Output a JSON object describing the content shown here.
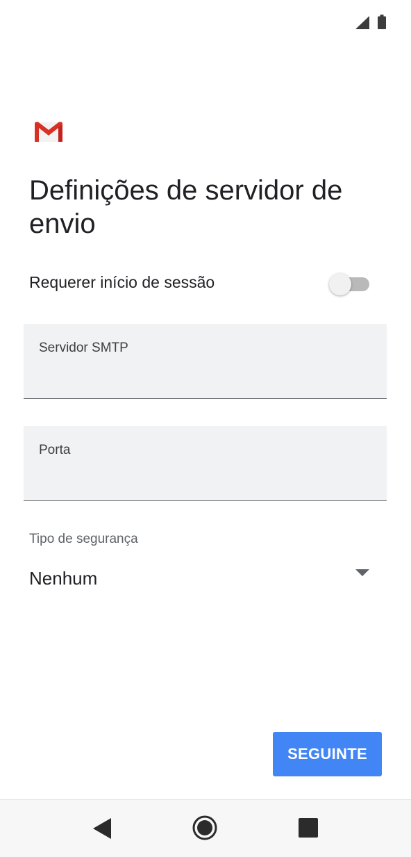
{
  "status_bar": {
    "icons": [
      "signal-icon",
      "battery-icon"
    ]
  },
  "app": {
    "logo": "gmail-logo",
    "title": "Definições de servidor de envio"
  },
  "settings": {
    "require_login": {
      "label": "Requerer início de sessão",
      "enabled": false
    },
    "smtp_server": {
      "label": "Servidor SMTP",
      "value": ""
    },
    "port": {
      "label": "Porta",
      "value": ""
    },
    "security_type": {
      "label": "Tipo de segurança",
      "selected": "Nenhum"
    }
  },
  "actions": {
    "next_label": "SEGUINTE"
  },
  "navigation": {
    "icons": [
      "back-icon",
      "home-icon",
      "recents-icon"
    ]
  },
  "colors": {
    "accent": "#4285f4",
    "gmail_red": "#d93025",
    "field_background": "#f1f2f4"
  }
}
